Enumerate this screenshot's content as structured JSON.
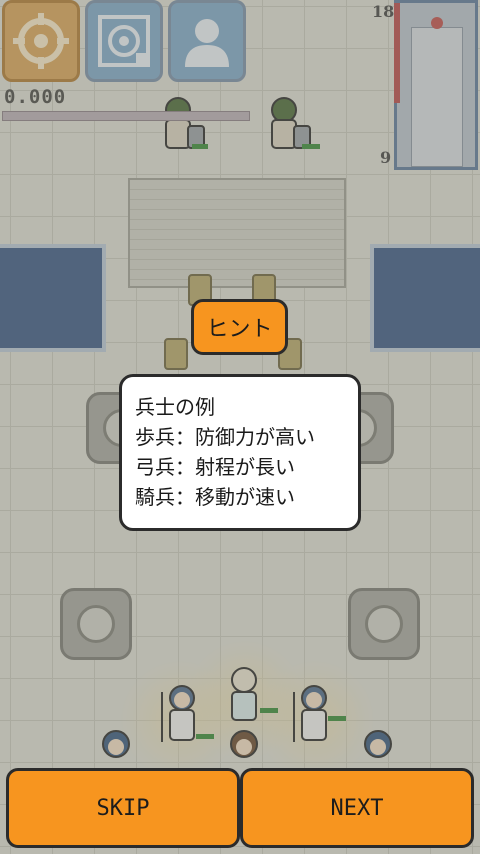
{
  "hud": {
    "score": "0.000",
    "buttons": [
      {
        "name": "target-icon",
        "color": "#d7a45a"
      },
      {
        "name": "radar-icon",
        "color": "#7fa8c8"
      },
      {
        "name": "profile-icon",
        "color": "#7fa8c8"
      }
    ]
  },
  "minimap": {
    "top_number": "18",
    "bottom_number": "9"
  },
  "hint": {
    "tag_label": "ヒント",
    "lines": [
      "兵士の例",
      "歩兵：防御力が高い",
      "弓兵：射程が長い",
      "騎兵：移動が速い"
    ]
  },
  "footer": {
    "skip_label": "SKIP",
    "next_label": "NEXT"
  },
  "colors": {
    "accent_orange": "#f7951f",
    "border_dark": "#2b2b2b",
    "pond_blue": "#3d5a86"
  }
}
